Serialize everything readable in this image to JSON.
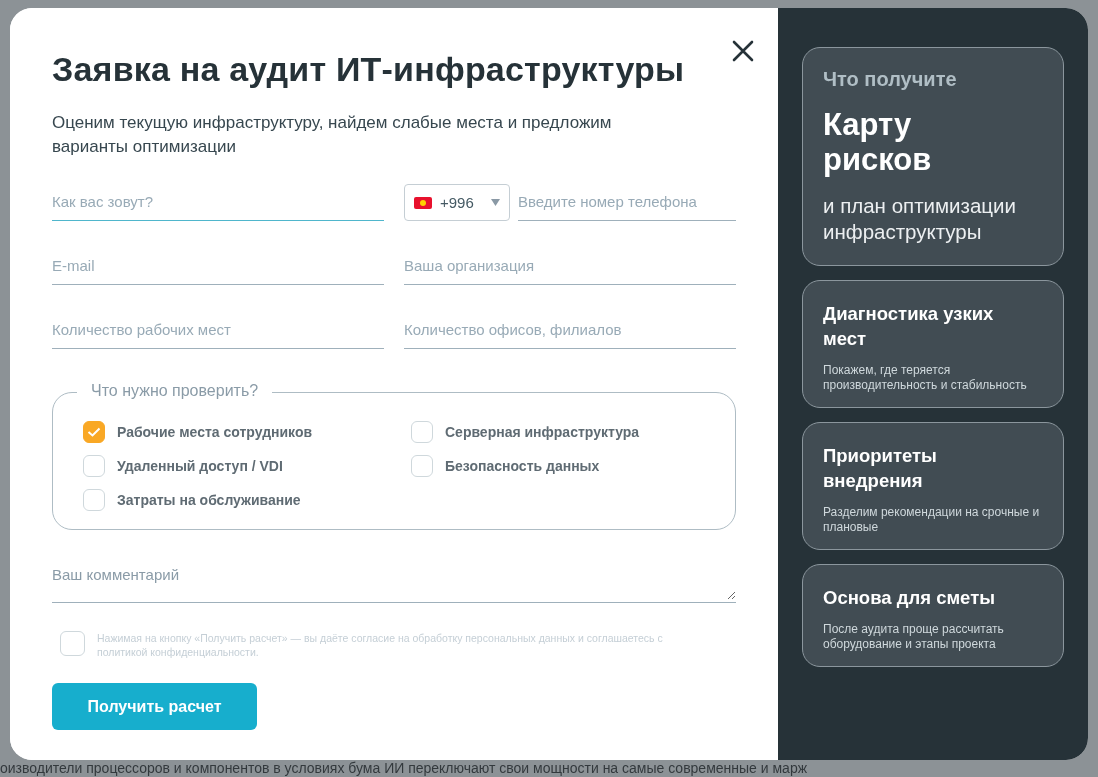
{
  "background": {
    "text_line": "оизводители процессоров и компонентов в условиях бума ИИ переключают свои мощности на самые современные и марж"
  },
  "dialog": {
    "title": "Заявка на аудит ИТ-инфраструктуры",
    "subtitle": "Оценим текущую инфраструктуру, найдем слабые места и предложим варианты оптимизации",
    "fields": [
      {
        "kind": "text",
        "placeholder": "Как вас зовут?",
        "focused": true
      },
      {
        "kind": "phone",
        "code": "+996",
        "placeholder": "Введите номер телефона",
        "focused": false
      },
      {
        "kind": "text",
        "placeholder": "E-mail",
        "focused": false
      },
      {
        "kind": "text",
        "placeholder": "Ваша организация",
        "focused": false
      },
      {
        "kind": "text",
        "placeholder": "Количество рабочих мест",
        "focused": false
      },
      {
        "kind": "text",
        "placeholder": "Количество офисов, филиалов",
        "focused": false
      }
    ],
    "checks": {
      "legend": "Что нужно проверить?",
      "items": [
        {
          "label": "Рабочие места сотрудников",
          "checked": true
        },
        {
          "label": "Серверная инфраструктура",
          "checked": false
        },
        {
          "label": "Удаленный доступ / VDI",
          "checked": false
        },
        {
          "label": "Безопасность данных",
          "checked": false
        },
        {
          "label": "Затраты на обслуживание",
          "checked": false
        }
      ]
    },
    "comment": {
      "placeholder": "Ваш комментарий"
    },
    "consent": {
      "text": "Нажимая на кнопку «Получить расчет» — вы даёте согласие на обработку персональных данных и соглашаетесь с политикой конфиденциальности.",
      "checked": false
    },
    "submit": "Получить расчет"
  },
  "side": {
    "cards": [
      {
        "kind": "hero",
        "eyebrow": "Что получите",
        "headline": "Карту рисков",
        "text": "и план оптимизации инфраструктуры"
      },
      {
        "kind": "feature",
        "title": "Диагностика узких мест",
        "text": "Покажем, где теряется производительность и стабильность"
      },
      {
        "kind": "feature",
        "title": "Приоритеты внедрения",
        "text": "Разделим рекомендации на срочные и плановые"
      },
      {
        "kind": "feature",
        "title": "Основа для сметы",
        "text": "После аудита проще рассчитать оборудование и этапы проекта"
      }
    ]
  }
}
